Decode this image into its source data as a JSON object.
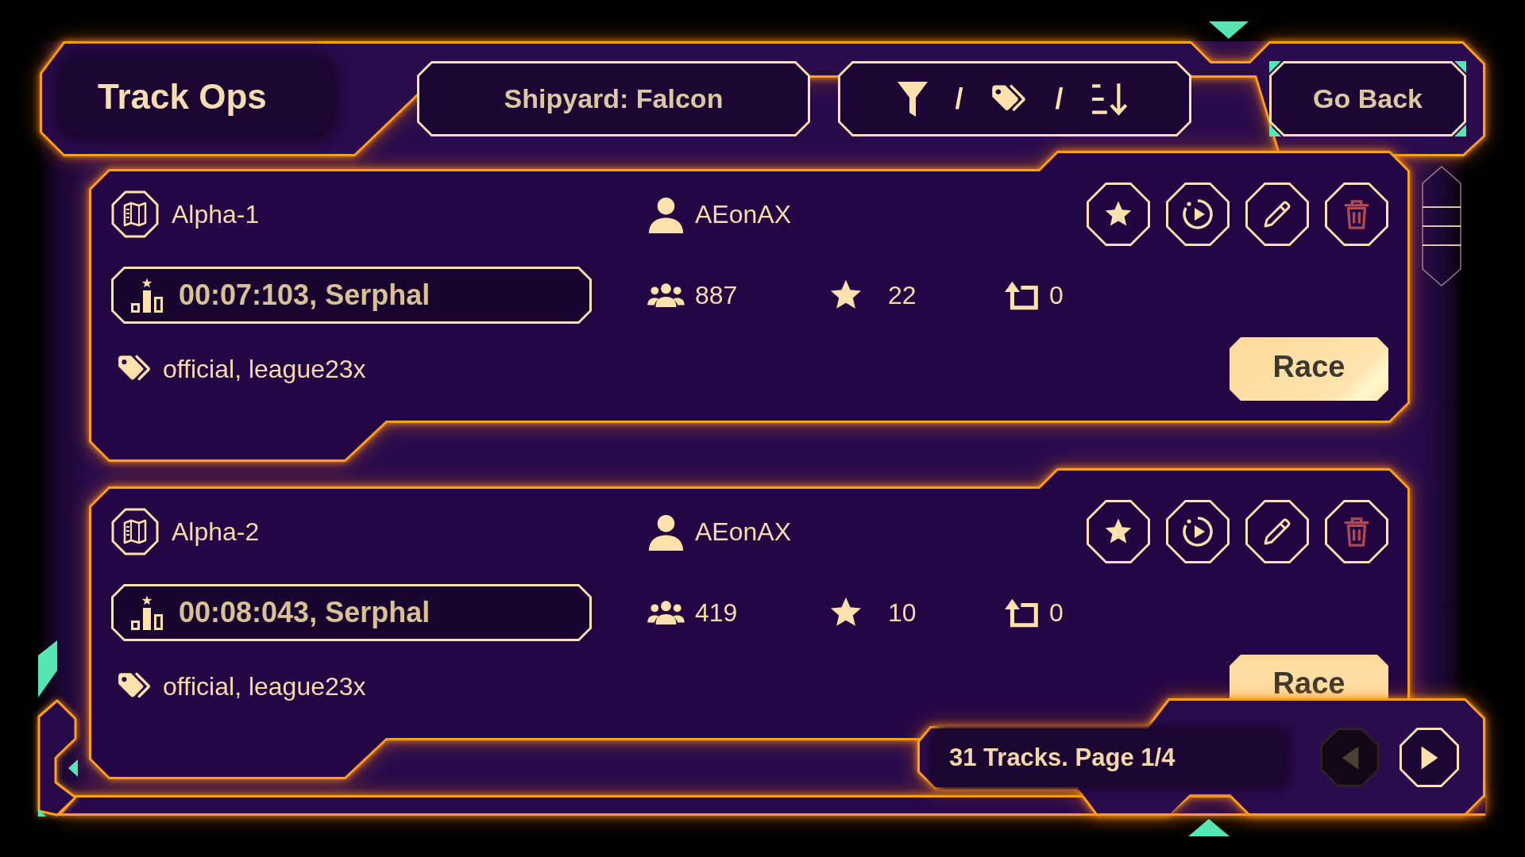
{
  "header": {
    "title": "Track Ops",
    "shipyard_button": "Shipyard: Falcon",
    "filter_button": {
      "separators": [
        "/",
        "/"
      ]
    },
    "back_button": "Go Back"
  },
  "tracks": [
    {
      "name": "Alpha-1",
      "author": "AEonAX",
      "record": "00:07:103, Serphal",
      "players": "887",
      "favorites": "22",
      "repeat_count": "0",
      "tags": "official, league23x",
      "race_button": "Race"
    },
    {
      "name": "Alpha-2",
      "author": "AEonAX",
      "record": "00:08:043, Serphal",
      "players": "419",
      "favorites": "10",
      "repeat_count": "0",
      "tags": "official, league23x",
      "race_button": "Race"
    }
  ],
  "footer": {
    "page_info": "31 Tracks. Page 1/4",
    "prev_button": {
      "disabled": true
    },
    "next_button": {
      "disabled": false
    }
  }
}
